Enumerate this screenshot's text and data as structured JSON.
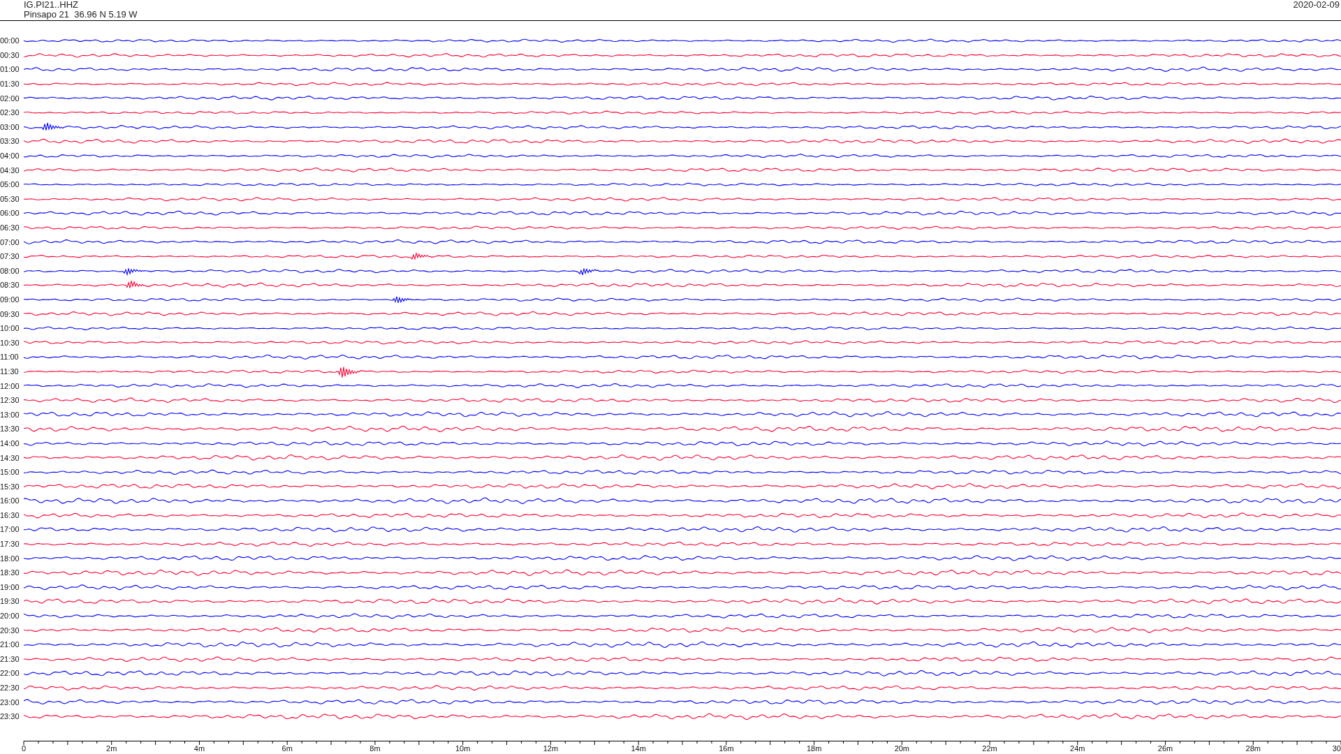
{
  "header": {
    "station": "IG.PI21..HHZ",
    "location": "Pinsapo 21  36.96 N 5.19 W",
    "date": "2020-02-09"
  },
  "traces": [
    {
      "time": "00:00",
      "color": "#0000ff"
    },
    {
      "time": "00:30",
      "color": "#ff0033"
    },
    {
      "time": "01:00",
      "color": "#0000ff"
    },
    {
      "time": "01:30",
      "color": "#ff0033"
    },
    {
      "time": "02:00",
      "color": "#0000ff"
    },
    {
      "time": "02:30",
      "color": "#ff0033"
    },
    {
      "time": "03:00",
      "color": "#0000ff"
    },
    {
      "time": "03:30",
      "color": "#ff0033"
    },
    {
      "time": "04:00",
      "color": "#0000ff"
    },
    {
      "time": "04:30",
      "color": "#ff0033"
    },
    {
      "time": "05:00",
      "color": "#0000ff"
    },
    {
      "time": "05:30",
      "color": "#ff0033"
    },
    {
      "time": "06:00",
      "color": "#0000ff"
    },
    {
      "time": "06:30",
      "color": "#ff0033"
    },
    {
      "time": "07:00",
      "color": "#0000ff"
    },
    {
      "time": "07:30",
      "color": "#ff0033"
    },
    {
      "time": "08:00",
      "color": "#0000ff"
    },
    {
      "time": "08:30",
      "color": "#ff0033"
    },
    {
      "time": "09:00",
      "color": "#0000ff"
    },
    {
      "time": "09:30",
      "color": "#ff0033"
    },
    {
      "time": "10:00",
      "color": "#0000ff"
    },
    {
      "time": "10:30",
      "color": "#ff0033"
    },
    {
      "time": "11:00",
      "color": "#0000ff"
    },
    {
      "time": "11:30",
      "color": "#ff0033"
    },
    {
      "time": "12:00",
      "color": "#0000ff"
    },
    {
      "time": "12:30",
      "color": "#ff0033"
    },
    {
      "time": "13:00",
      "color": "#0000ff"
    },
    {
      "time": "13:30",
      "color": "#ff0033"
    },
    {
      "time": "14:00",
      "color": "#0000ff"
    },
    {
      "time": "14:30",
      "color": "#ff0033"
    },
    {
      "time": "15:00",
      "color": "#0000ff"
    },
    {
      "time": "15:30",
      "color": "#ff0033"
    },
    {
      "time": "16:00",
      "color": "#0000ff"
    },
    {
      "time": "16:30",
      "color": "#ff0033"
    },
    {
      "time": "17:00",
      "color": "#0000ff"
    },
    {
      "time": "17:30",
      "color": "#ff0033"
    },
    {
      "time": "18:00",
      "color": "#0000ff"
    },
    {
      "time": "18:30",
      "color": "#ff0033"
    },
    {
      "time": "19:00",
      "color": "#0000ff"
    },
    {
      "time": "19:30",
      "color": "#ff0033"
    },
    {
      "time": "20:00",
      "color": "#0000ff"
    },
    {
      "time": "20:30",
      "color": "#ff0033"
    },
    {
      "time": "21:00",
      "color": "#0000ff"
    },
    {
      "time": "21:30",
      "color": "#ff0033"
    },
    {
      "time": "22:00",
      "color": "#0000ff"
    },
    {
      "time": "22:30",
      "color": "#ff0033"
    },
    {
      "time": "23:00",
      "color": "#0000ff"
    },
    {
      "time": "23:30",
      "color": "#ff0033"
    }
  ],
  "axis": {
    "ticks": [
      "0",
      "2m",
      "4m",
      "6m",
      "8m",
      "10m",
      "12m",
      "14m",
      "16m",
      "18m",
      "20m",
      "22m",
      "24m",
      "26m",
      "28m",
      "30"
    ]
  }
}
